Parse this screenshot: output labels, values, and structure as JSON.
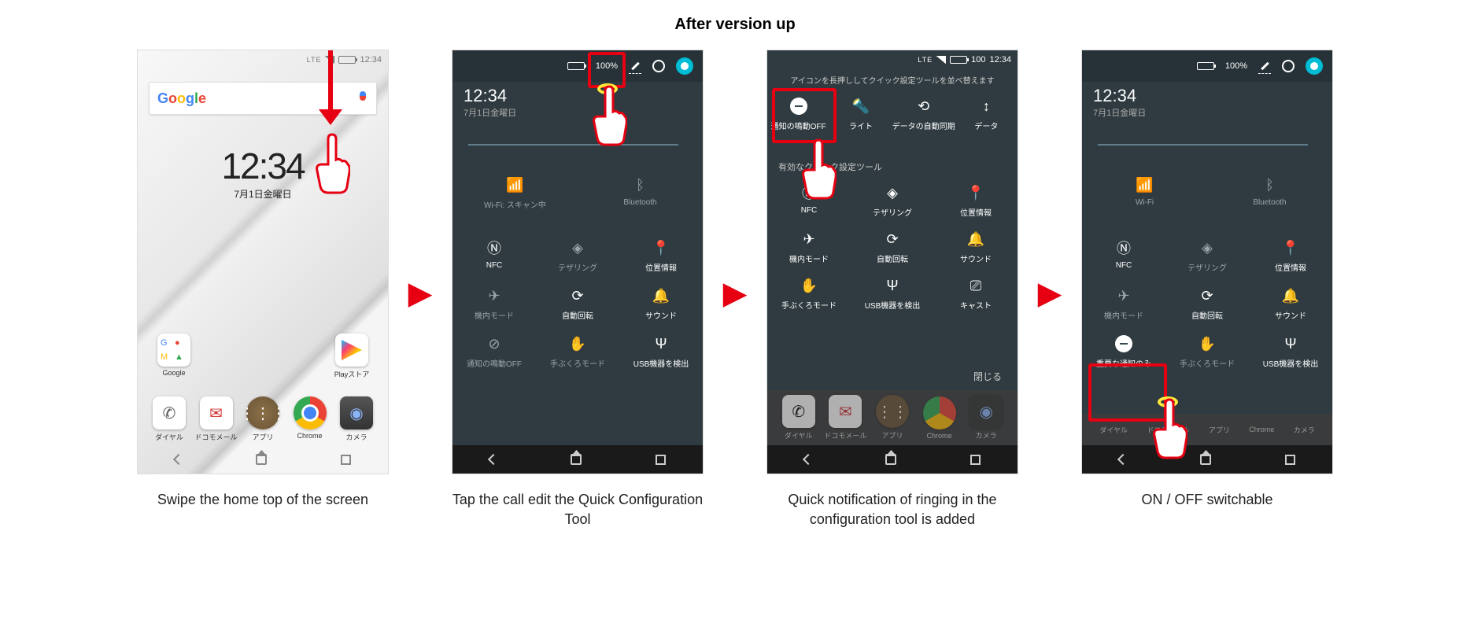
{
  "heading": "After version up",
  "arrow": "▶",
  "captions": [
    "Swipe the home top of the screen",
    "Tap the call edit the Quick Configuration Tool",
    "Quick notification of ringing in the configuration tool is added",
    "ON / OFF switchable"
  ],
  "status": {
    "lte": "LTE",
    "batt100": "100",
    "time": "12:34"
  },
  "home": {
    "clock_time": "12:34",
    "clock_date": "7月1日金曜日",
    "google": [
      "G",
      "o",
      "o",
      "g",
      "l",
      "e"
    ],
    "folder_label": "Google",
    "play_label": "Playストア",
    "dock": [
      {
        "label": "ダイヤル"
      },
      {
        "label": "ドコモメール"
      },
      {
        "label": "アプリ"
      },
      {
        "label": "Chrome"
      },
      {
        "label": "カメラ"
      }
    ]
  },
  "qs": {
    "time": "12:34",
    "date": "7月1日金曜日",
    "batt_text": "100%",
    "tiles2": [
      {
        "label": "Wi-Fi: スキャン中",
        "sub": "▾"
      },
      {
        "label": "Bluetooth",
        "sub": "▾"
      },
      {
        "label": "NFC"
      },
      {
        "label": "テザリング"
      },
      {
        "label": "位置情報"
      },
      {
        "label": "機内モード"
      },
      {
        "label": "自動回転"
      },
      {
        "label": "サウンド"
      },
      {
        "label": "通知の鳴動OFF"
      },
      {
        "label": "手ぶくろモード"
      },
      {
        "label": "USB機器を検出"
      }
    ],
    "tiles4_top": [
      {
        "label": "Wi-Fi",
        "sub": "▾"
      },
      {
        "label": "Bluetooth",
        "sub": "▾"
      }
    ],
    "tiles4": [
      {
        "label": "NFC"
      },
      {
        "label": "テザリング"
      },
      {
        "label": "位置情報"
      },
      {
        "label": "機内モード"
      },
      {
        "label": "自動回転"
      },
      {
        "label": "サウンド"
      },
      {
        "label": "重要な通知のみ"
      },
      {
        "label": "手ぶくろモード"
      },
      {
        "label": "USB機器を検出"
      }
    ]
  },
  "step3": {
    "hint": "アイコンを長押ししてクイック設定ツールを並べ替えます",
    "row1": [
      {
        "label": "通知の鳴動OFF"
      },
      {
        "label": "ライト"
      },
      {
        "label": "データの自動同期"
      },
      {
        "label": "データ"
      }
    ],
    "section": "有効なクイック設定ツール",
    "grid": [
      {
        "label": "NFC"
      },
      {
        "label": "テザリング"
      },
      {
        "label": "位置情報"
      },
      {
        "label": "機内モード"
      },
      {
        "label": "自動回転"
      },
      {
        "label": "サウンド"
      },
      {
        "label": "手ぶくろモード"
      },
      {
        "label": "USB機器を検出"
      },
      {
        "label": "キャスト"
      }
    ],
    "close": "閉じる"
  }
}
